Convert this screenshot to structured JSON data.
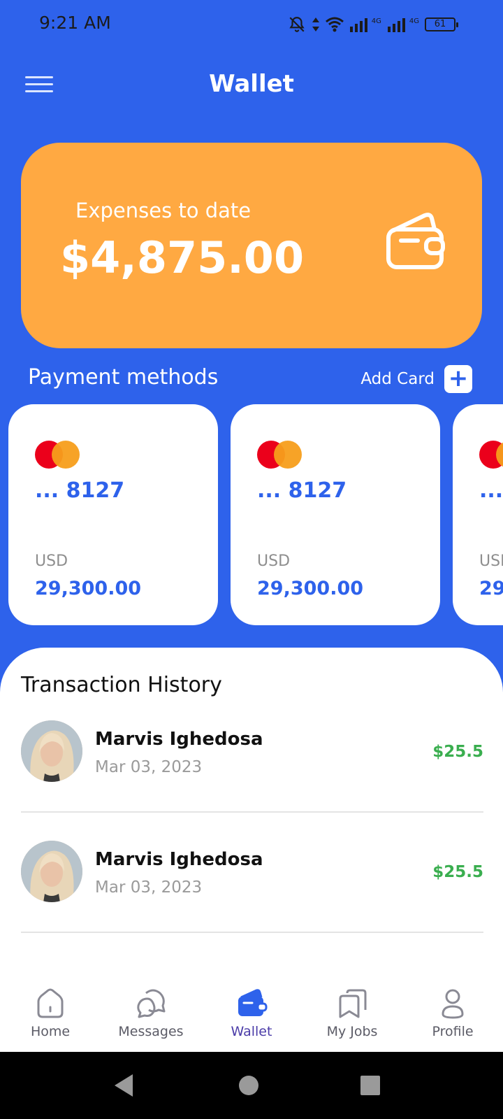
{
  "status_bar": {
    "time": "9:21 AM",
    "network_1": "4G",
    "network_2": "4G",
    "battery": "61"
  },
  "header": {
    "title": "Wallet",
    "menu_icon": "hamburger-menu-icon"
  },
  "expenses": {
    "label": "Expenses to date",
    "value": "$4,875.00",
    "icon": "wallet-icon"
  },
  "payment_methods": {
    "title": "Payment methods",
    "add_label": "Add Card",
    "add_icon": "+",
    "cards": [
      {
        "number": "... 8127",
        "currency": "USD",
        "balance": "29,300.00",
        "brand_icon": "mastercard-logo"
      },
      {
        "number": "... 8127",
        "currency": "USD",
        "balance": "29,300.00",
        "brand_icon": "mastercard-logo"
      },
      {
        "number": "...",
        "currency": "USD",
        "balance": "29",
        "brand_icon": "mastercard-logo"
      }
    ]
  },
  "transactions": {
    "title": "Transaction History",
    "items": [
      {
        "name": "Marvis Ighedosa",
        "date": "Mar 03, 2023",
        "amount": "$25.5"
      },
      {
        "name": "Marvis Ighedosa",
        "date": "Mar 03, 2023",
        "amount": "$25.5"
      }
    ]
  },
  "bottom_nav": {
    "items": [
      {
        "label": "Home",
        "icon": "home-icon"
      },
      {
        "label": "Messages",
        "icon": "messages-icon"
      },
      {
        "label": "Wallet",
        "icon": "wallet-icon"
      },
      {
        "label": "My Jobs",
        "icon": "bookmarks-icon"
      },
      {
        "label": "Profile",
        "icon": "profile-icon"
      }
    ],
    "active": "Wallet"
  },
  "colors": {
    "background": "#2E62EB",
    "expense_card": "#FFA942",
    "amount_positive": "#3AAE4F",
    "active_nav": "#4B3CA8"
  }
}
